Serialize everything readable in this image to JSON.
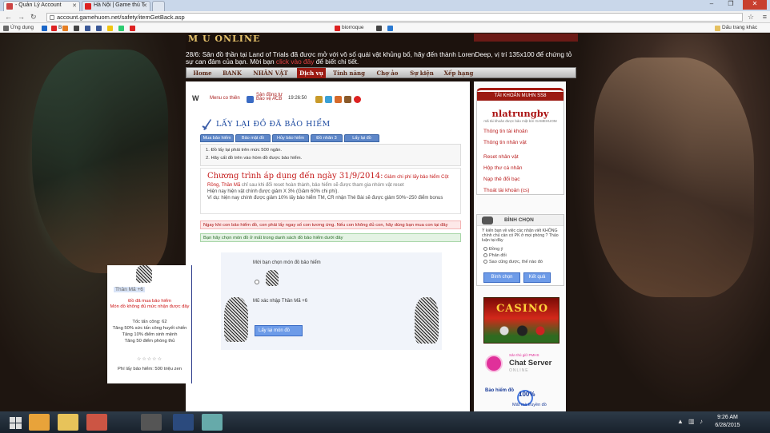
{
  "browser": {
    "tabs": [
      {
        "label": "- Quản Lý Account"
      },
      {
        "label": "Hà Nội | Game thủ T"
      }
    ],
    "url": "account.gamehuom.net/safety/itemGetBack.asp",
    "bookmarks": [
      {
        "label": "Ứng dụng",
        "color": "#6a6a6a"
      },
      {
        "label": "",
        "color": "#1a66c8"
      },
      {
        "label": "B",
        "color": "#d22"
      },
      {
        "label": "",
        "color": "#e67e22"
      },
      {
        "label": "",
        "color": "#444"
      },
      {
        "label": "",
        "color": "#3b5998"
      },
      {
        "label": "",
        "color": "#3b5998"
      },
      {
        "label": "",
        "color": "#f1c40f"
      },
      {
        "label": "",
        "color": "#2ecc71"
      },
      {
        "label": "",
        "color": "#d22"
      },
      {
        "label": "biorroque",
        "color": "#d22"
      },
      {
        "label": "",
        "color": "#444"
      },
      {
        "label": "",
        "color": "#2a7ad2"
      }
    ],
    "other_bookmarks": "Dấu trang khác"
  },
  "page": {
    "game_logo": "M U ONLINE",
    "news": {
      "prefix": "28/6: Sân đồ thần tại Land of Trials đã được mở với vô số quái vật khủng bố, hãy đến thành LorenDeep, vị trí 135x100 để chứng tỏ sự can đảm của bạn. Mời bạn ",
      "link": "click vào đây",
      "suffix": " để biết chi tiết."
    },
    "nav": [
      "Home",
      "BANK",
      "NHÂN VẬT",
      "Dịch vụ",
      "Tính năng",
      "Chợ ảo",
      "Sự kiện",
      "Xếp hạng"
    ],
    "active_nav_index": 3,
    "icon_strip": {
      "menu_label": "Menu co thiên",
      "reg_label": "Sản đồng tự Bảo vệ ACB",
      "time": "19:26:50"
    },
    "title": "LẤY LẠI ĐỒ ĐÃ BẢO HIỂM",
    "subtabs": [
      "Mua bảo hiểm",
      "Bảo mật đồ",
      "Hủy bảo hiểm",
      "Đồ nhân 3",
      "Lấy lại đồ"
    ],
    "notes": [
      "1. Đồ lấy lại phải trên mức 500 ngân.",
      "2. Hãy cất đồ trên vào hòm đồ được bảo hiểm."
    ],
    "promo": {
      "headline": "Chương trình áp dụng đến ngày 31/9/2014:",
      "lead": " Giảm chi phí lấy bảo hiểm Cột Rồng, Thần Mã",
      "rest": " chỉ sau khi đổi reset hoàn thành, bảo hiểm sẽ được tham gia nhóm vật reset ",
      "line2": "Hiện nay hiện vật chính được giảm X 3% (Giảm 60% chi phí).",
      "line3": "Ví dụ: hiện nay chính được giảm 10% lấy bảo hiểm TM, CR nhận Thẻ Bài sẽ được giảm 50%~250 điểm bonus"
    },
    "warning": "Ngay khi con bảo hiểm đồ, con phải lấy ngay số con tương ứng. Nếu con không đủ con, hãy dùng bạn mua con tại đây",
    "info": "Bạn hãy chọn món đồ ở mất trong danh sách đồ bảo hiểm dưới đây",
    "item_select": {
      "label": "Mời bạn chọn món đồ bảo hiểm",
      "item_name": "Mũ xác nhập Thần Mã +6",
      "button": "Lấy lại món đồ"
    },
    "popup": {
      "name": "Thần Mã +6",
      "err1": "Đồ đã mua bảo hiểm",
      "err2": "Món đồ không đủ mức nhận được đây",
      "stats": [
        "Tốc tấn công: 62",
        "Tăng 50% sức tấn công huyết chiến",
        "Tăng 10% điểm sinh mệnh",
        "Tăng 50 điểm phòng thủ"
      ],
      "stars": "☆☆☆☆☆",
      "fee": "Phí lấy bảo hiểm: 500 triệu zen"
    },
    "sidebar": {
      "account_header": "TÀI KHOẢN MUHN SS8",
      "username": "nlatrungby",
      "username_sub": "mã tài khoản được bảo mật bởi GAMEHUOM",
      "links": [
        "Thông tin tài khoản",
        "Thông tin nhân vật",
        "Reset nhân vật",
        "Hộp thư cá nhân",
        "Nạp thẻ đổi bạc",
        "Thoát tài khoản (cs)"
      ],
      "vote_header": "BÌNH CHỌN",
      "vote_question": "Ý kiến bạn về việc các nhận viết KHÔNG chính chủ cần có PK ở mọi phòng ? Thảo luận tại đây",
      "vote_options": [
        "Đồng ý",
        "Phản đối",
        "Sao cũng được, thế nào đó"
      ],
      "vote_btn": "Bình chọn",
      "result_btn": "Kết quả",
      "casino": "CASINO",
      "chat_pre": "Sản thủ giữ PMHS",
      "chat_main": "Chat Server",
      "chat_sub": "ONLINE",
      "insurance_l1": "Bảo hiểm đồ",
      "insurance_l2": "100%",
      "insurance_l3": "Mất mà truyền đồ"
    }
  },
  "taskbar": {
    "time": "9:26 AM",
    "date": "6/28/2015",
    "apps": [
      {
        "name": "chrome",
        "color": "#e8a33a"
      },
      {
        "name": "explorer",
        "color": "#e7c35a"
      },
      {
        "name": "app-red",
        "color": "#c54"
      },
      {
        "name": "app-dark",
        "color": "#555"
      },
      {
        "name": "photoshop",
        "color": "#2b4a7d"
      },
      {
        "name": "app-pencil",
        "color": "#6aa"
      }
    ]
  }
}
